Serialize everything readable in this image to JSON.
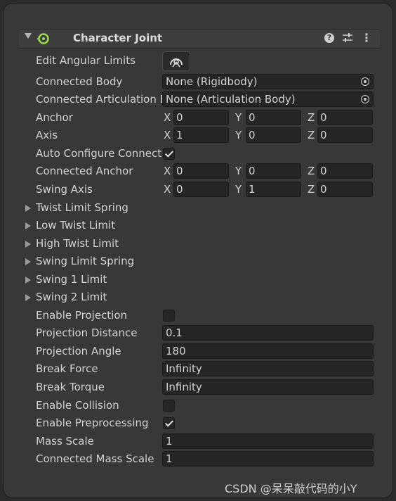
{
  "component": {
    "title": "Character Joint",
    "help_icon": "help-icon",
    "presets_icon": "presets-icon",
    "menu_icon": "kebab-menu-icon"
  },
  "edit_angular_limits": {
    "label": "Edit Angular Limits",
    "icon": "edit-angular-limits-icon"
  },
  "connected_body": {
    "label": "Connected Body",
    "value": "None (Rigidbody)"
  },
  "connected_articulation": {
    "label": "Connected Articulation B",
    "value": "None (Articulation Body)"
  },
  "anchor": {
    "label": "Anchor",
    "x": "0",
    "y": "0",
    "z": "0"
  },
  "axis": {
    "label": "Axis",
    "x": "1",
    "y": "0",
    "z": "0"
  },
  "auto_configure": {
    "label": "Auto Configure Connecte",
    "checked": true
  },
  "connected_anchor": {
    "label": "Connected Anchor",
    "x": "0",
    "y": "0",
    "z": "0"
  },
  "swing_axis": {
    "label": "Swing Axis",
    "x": "0",
    "y": "1",
    "z": "0"
  },
  "axis_letters": {
    "x": "X",
    "y": "Y",
    "z": "Z"
  },
  "foldouts": [
    "Twist Limit Spring",
    "Low Twist Limit",
    "High Twist Limit",
    "Swing Limit Spring",
    "Swing 1 Limit",
    "Swing 2 Limit"
  ],
  "enable_projection": {
    "label": "Enable Projection",
    "checked": false
  },
  "projection_distance": {
    "label": "Projection Distance",
    "value": "0.1"
  },
  "projection_angle": {
    "label": "Projection Angle",
    "value": "180"
  },
  "break_force": {
    "label": "Break Force",
    "value": "Infinity"
  },
  "break_torque": {
    "label": "Break Torque",
    "value": "Infinity"
  },
  "enable_collision": {
    "label": "Enable Collision",
    "checked": false
  },
  "enable_preprocessing": {
    "label": "Enable Preprocessing",
    "checked": true
  },
  "mass_scale": {
    "label": "Mass Scale",
    "value": "1"
  },
  "connected_mass_scale": {
    "label": "Connected Mass Scale",
    "value": "1"
  },
  "watermark": "CSDN @呆呆敲代码的小Y"
}
